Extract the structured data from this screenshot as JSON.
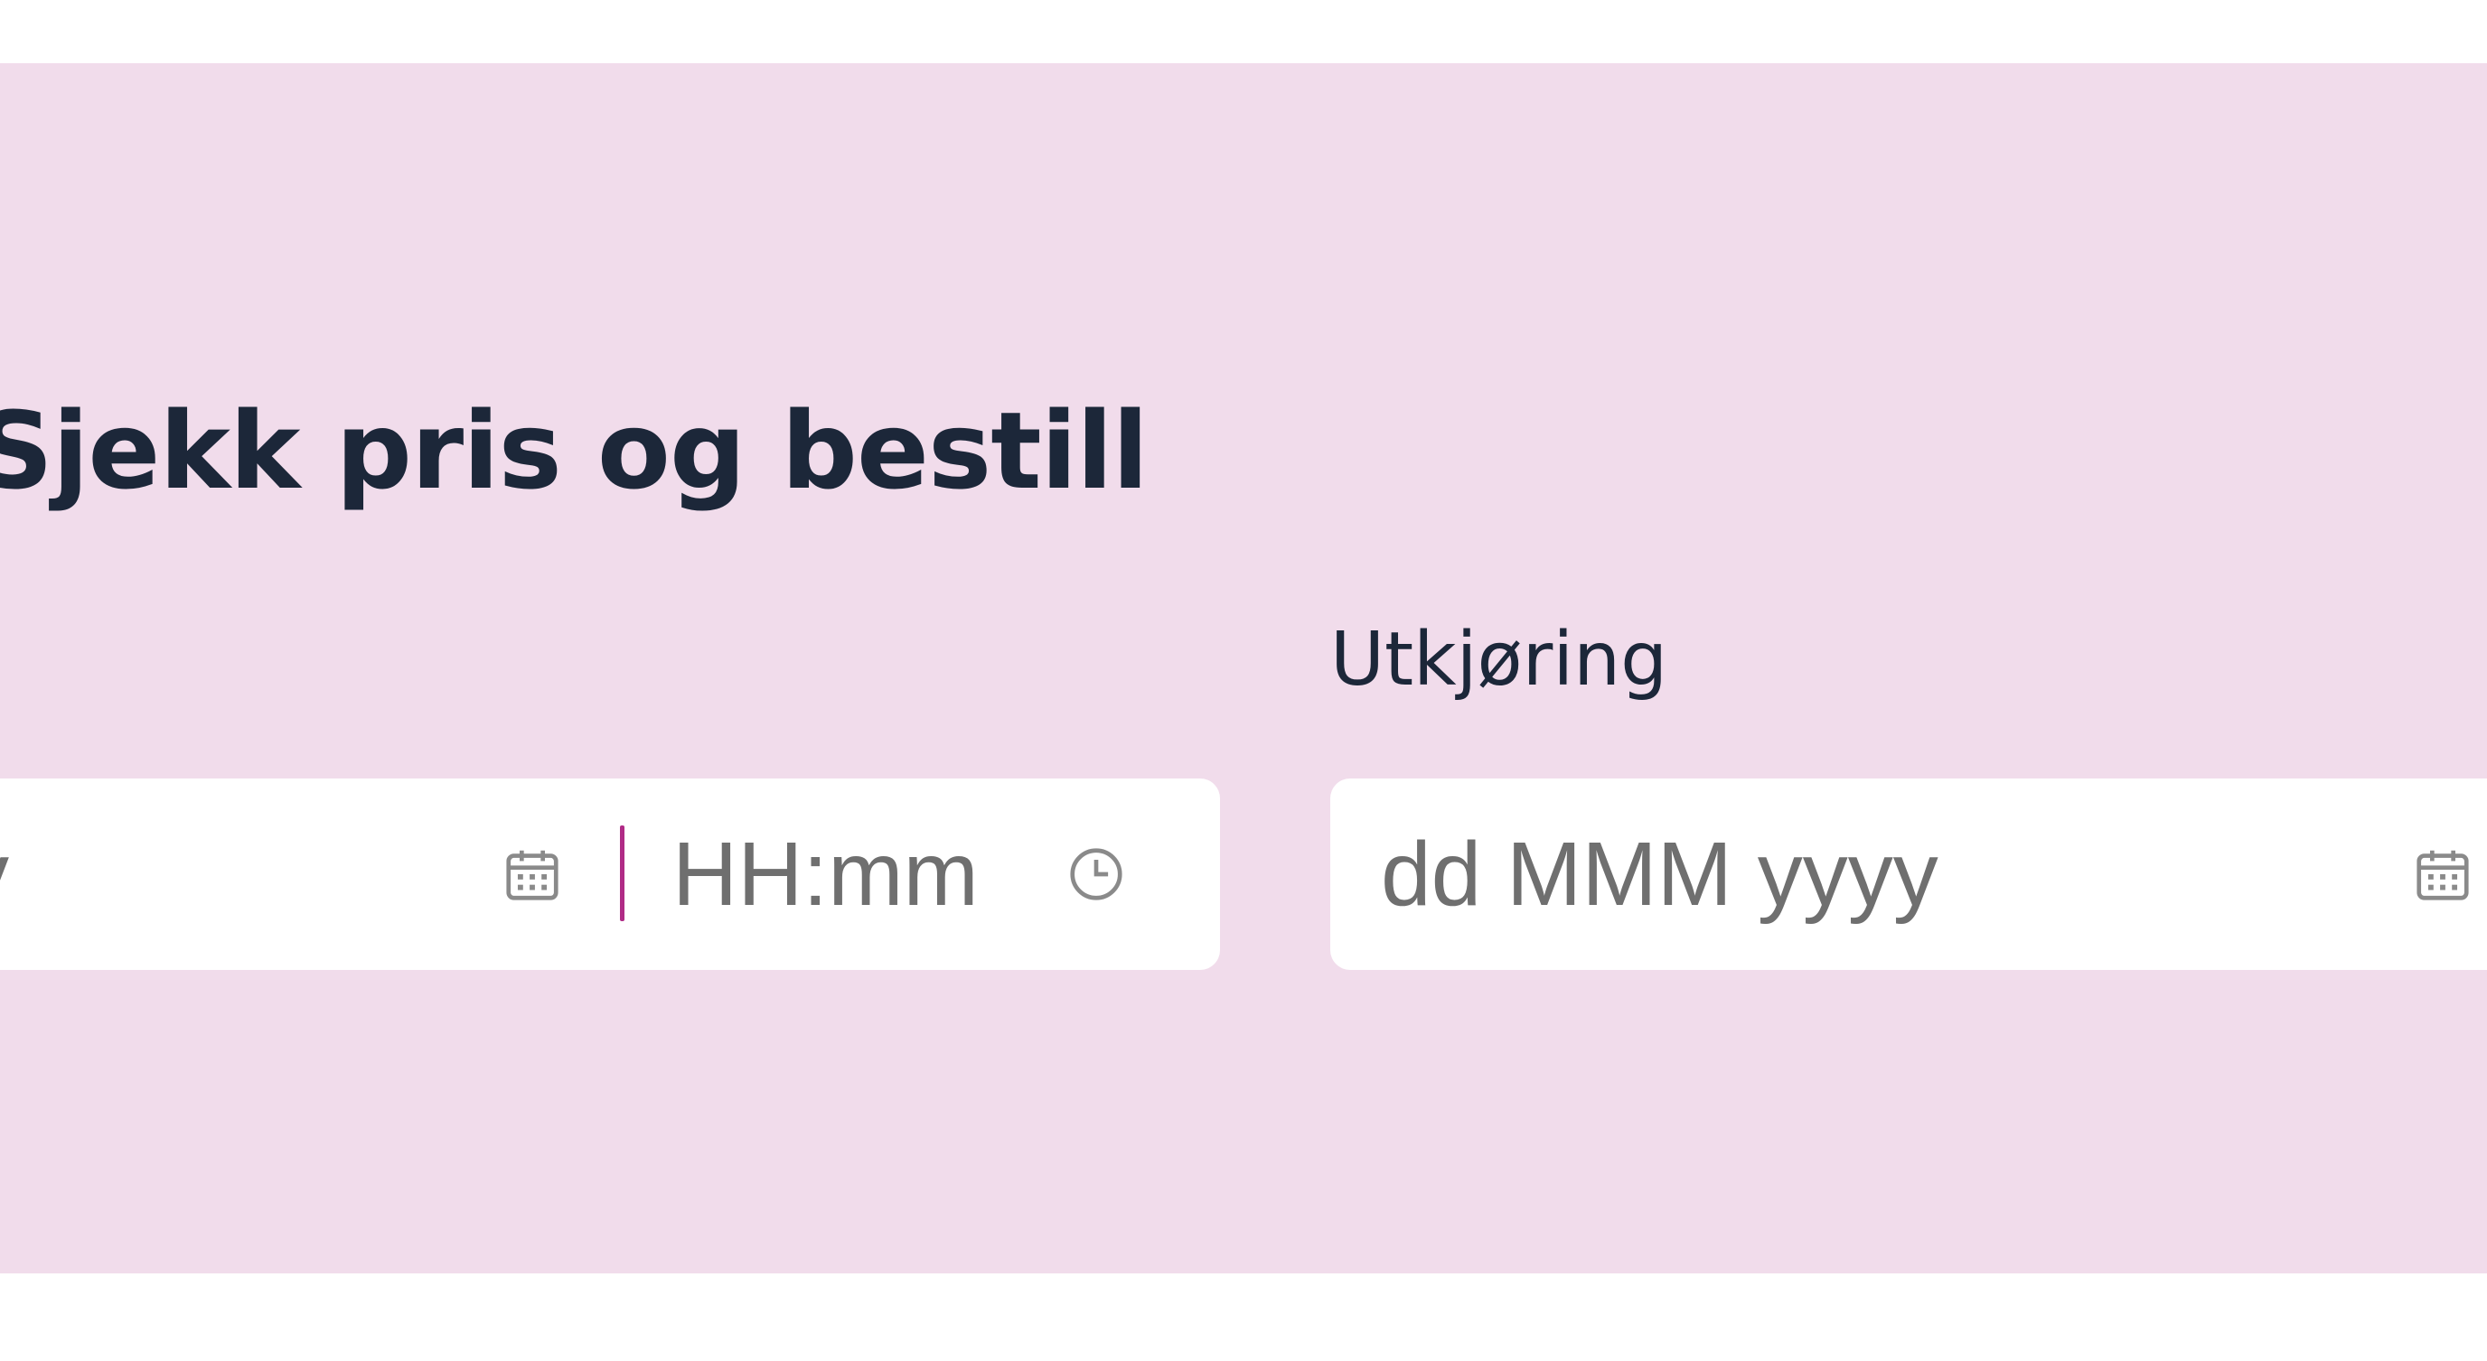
{
  "form": {
    "title": "Sjekk pris og bestill",
    "checkin": {
      "date_placeholder_visible": "y",
      "time_placeholder": "HH:mm"
    },
    "checkout": {
      "label": "Utkjøring",
      "date_placeholder": "dd MMM yyyy"
    }
  },
  "icons": {
    "date": "calendar-icon",
    "time": "clock-icon"
  },
  "colors": {
    "panel_background": "#f1dceb",
    "title_text": "#1c2739",
    "placeholder_text": "#6f6f6f",
    "divider_accent": "#b02b86",
    "field_background": "#ffffff"
  }
}
